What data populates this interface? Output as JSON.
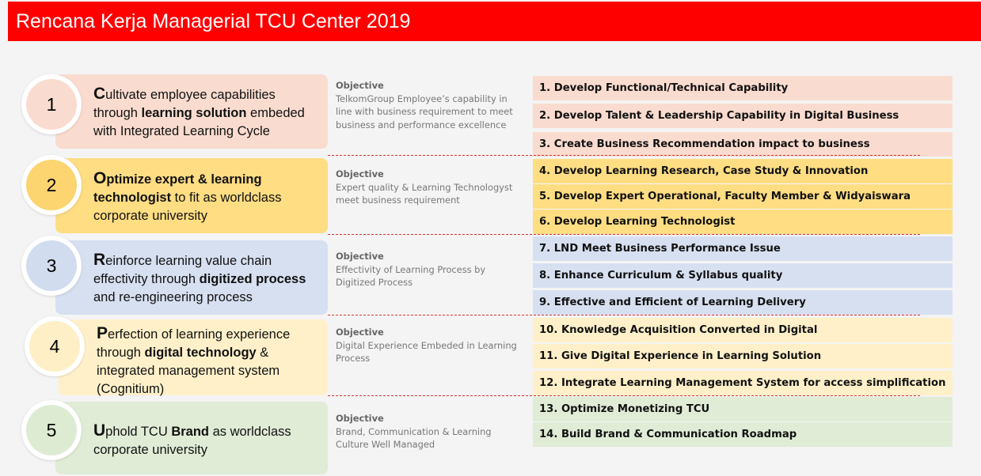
{
  "title": "Rencana Kerja Managerial TCU Center 2019",
  "pillars": [
    {
      "number": "1",
      "cap": "C",
      "parts": [
        "ultivate employee capabilities through ",
        "learning solution",
        " embeded with Integrated Learning Cycle"
      ],
      "objective_label": "Objective",
      "objective": "TelkomGroup Employee’s capability in line with business requirement to meet business and performance excellence"
    },
    {
      "number": "2",
      "cap": "O",
      "parts": [
        "ptimize ",
        "expert & learning technologist",
        " to fit as worldclass corporate university"
      ],
      "objective_label": "Objective",
      "objective": "Expert quality & Learning Technologyst meet business requirement"
    },
    {
      "number": "3",
      "cap": "R",
      "parts": [
        "einforce learning value chain effectivity through ",
        "digitized process",
        " and re-engineering process"
      ],
      "objective_label": "Objective",
      "objective": "Effectivity of Learning Process by Digitized Process"
    },
    {
      "number": "4",
      "cap": "P",
      "parts": [
        "erfection of learning experience through ",
        "digital technology",
        " & integrated management system (Cognitium)"
      ],
      "objective_label": "Objective",
      "objective": "Digital Experience Embeded in Learning Process"
    },
    {
      "number": "5",
      "cap": "U",
      "parts": [
        "phold TCU ",
        "Brand",
        " as worldclass corporate university"
      ],
      "objective_label": "Objective",
      "objective": "Brand, Communication & Learning Culture Well Managed"
    }
  ],
  "programs": [
    "1. Develop Functional/Technical Capability",
    "2. Develop Talent & Leadership Capability in Digital Business",
    "3. Create Business Recommendation impact to business",
    "4. Develop Learning Research, Case Study & Innovation",
    "5. Develop Expert Operational, Faculty Member & Widyaiswara",
    "6. Develop Learning Technologist",
    "7. LND Meet Business Performance Issue",
    "8. Enhance Curriculum & Syllabus quality",
    "9. Effective and Efficient of Learning Delivery",
    "10. Knowledge Acquisition Converted in Digital",
    "11. Give Digital Experience in Learning Solution",
    "12. Integrate Learning Management System for access simplification",
    "13. Optimize Monetizing TCU",
    "14. Build Brand & Communication Roadmap"
  ],
  "colors": {
    "title_bar": "#ff0000",
    "pillar_1": "#f9dccf",
    "pillar_2": "#fedd83",
    "pillar_3": "#d7e0f1",
    "pillar_4": "#fff0c9",
    "pillar_5": "#e0ecd6",
    "separator": "#e03030"
  }
}
